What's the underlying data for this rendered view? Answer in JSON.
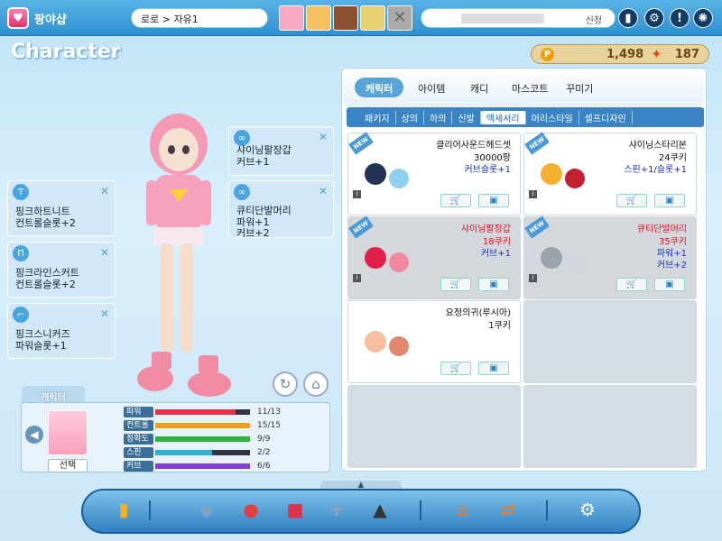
{
  "header": {
    "logo_text": "팡야샵",
    "location": "로로 > 자유1",
    "search_button": "신청",
    "icons": [
      "phone-icon",
      "gears-icon",
      "help-icon",
      "settings-icon"
    ]
  },
  "title": "Character",
  "currency": {
    "pang": "1,498",
    "cookie": "187"
  },
  "equipped": [
    {
      "name": "샤이닝팔장갑",
      "stat": "커브+1"
    },
    {
      "name": "큐티단발머리",
      "stat": "파워+1",
      "stat2": "커브+2"
    },
    {
      "name": "핑크하트니트",
      "stat": "컨트롤슬롯+2"
    },
    {
      "name": "핑크라인스커트",
      "stat": "컨트롤슬롯+2"
    },
    {
      "name": "핑크스니커즈",
      "stat": "파워슬롯+1"
    }
  ],
  "character_panel": {
    "tab_label": "캐릭터",
    "select_label": "선택",
    "stats": [
      {
        "label": "파워",
        "value": "11/13",
        "fraction": 0.85,
        "color": "#e0304a"
      },
      {
        "label": "컨트롤",
        "value": "15/15",
        "fraction": 1.0,
        "color": "#f0a020"
      },
      {
        "label": "정확도",
        "value": "9/9",
        "fraction": 1.0,
        "color": "#30b040"
      },
      {
        "label": "스핀",
        "value": "2/2",
        "fraction": 0.6,
        "color": "#30b0d0"
      },
      {
        "label": "커브",
        "value": "6/6",
        "fraction": 1.0,
        "color": "#8040d0"
      }
    ]
  },
  "shop": {
    "tabs": [
      "캐릭터",
      "아이템",
      "캐디",
      "마스코트",
      "꾸미기"
    ],
    "subtabs": [
      "패키지",
      "상의",
      "하의",
      "신발",
      "액세서리",
      "머리스타일",
      "셀프디자인"
    ],
    "items": [
      {
        "name": "클리어사운드헤드셋",
        "price": "30000팡",
        "effect": "커브슬롯+1",
        "effect2": "",
        "is_new": true,
        "red": false
      },
      {
        "name": "샤이닝스타리본",
        "price": "24쿠키",
        "effect": "스핀+1/슬롯+1",
        "effect2": "",
        "is_new": true,
        "red": false
      },
      {
        "name": "샤이닝팔장갑",
        "price": "18쿠키",
        "effect": "커브+1",
        "effect2": "",
        "is_new": true,
        "red": true
      },
      {
        "name": "큐티단발머리",
        "price": "35쿠키",
        "effect": "파워+1",
        "effect2": "커브+2",
        "is_new": true,
        "red": true
      },
      {
        "name": "요정의귀(루시아)",
        "price": "1쿠키",
        "effect": "",
        "effect2": "",
        "is_new": false,
        "red": false
      }
    ]
  }
}
